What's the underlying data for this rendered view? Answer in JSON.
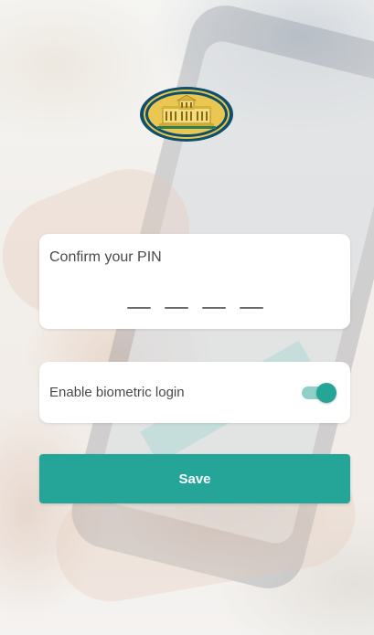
{
  "theme": {
    "accent": "#24a597",
    "toggle_track": "#8fd0c8",
    "logo_ring": "#0e4f6e",
    "logo_fill": "#e8c64a"
  },
  "logo": {
    "icon": "bank-building-logo-icon"
  },
  "pin": {
    "label": "Confirm your PIN",
    "slot_count": 4
  },
  "biometric": {
    "label": "Enable biometric login",
    "enabled": true,
    "toggle_icon": "toggle-switch-icon"
  },
  "actions": {
    "save_label": "Save"
  }
}
